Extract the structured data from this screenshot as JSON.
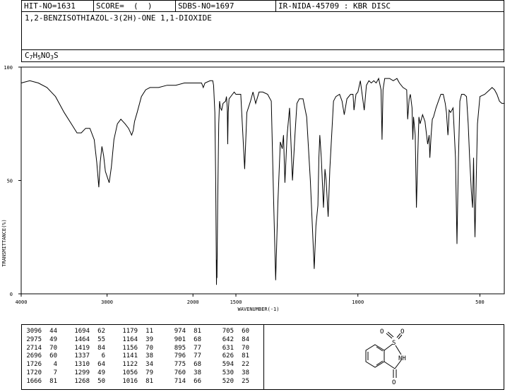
{
  "header": {
    "hit_no": "HIT-NO=1631",
    "score": "SCORE=  (  )",
    "sdbs_no": "SDBS-NO=1697",
    "source": "IR-NIDA-45709 : KBR DISC"
  },
  "compound": {
    "name": "1,2-BENZISOTHIAZOL-3(2H)-ONE 1,1-DIOXIDE",
    "formula_parts": [
      {
        "text": "C",
        "sub": false
      },
      {
        "text": "7",
        "sub": true
      },
      {
        "text": "H",
        "sub": false
      },
      {
        "text": "5",
        "sub": true
      },
      {
        "text": "NO",
        "sub": false
      },
      {
        "text": "3",
        "sub": true
      },
      {
        "text": "S",
        "sub": false
      }
    ]
  },
  "chart_data": {
    "type": "line",
    "title": "",
    "xlabel": "WAVENUMBER(-1)",
    "ylabel": "TRANSMITTANCE(%)",
    "xlim": [
      4000,
      400
    ],
    "ylim": [
      0,
      100
    ],
    "x_ticks": [
      4000,
      3000,
      2000,
      1500,
      1000,
      500
    ],
    "y_ticks": [
      0,
      50,
      100
    ],
    "grid": false,
    "series": [
      {
        "points": [
          [
            4000,
            93
          ],
          [
            3900,
            94
          ],
          [
            3800,
            93
          ],
          [
            3700,
            91
          ],
          [
            3600,
            87
          ],
          [
            3500,
            80
          ],
          [
            3400,
            74
          ],
          [
            3350,
            71
          ],
          [
            3300,
            71
          ],
          [
            3250,
            73
          ],
          [
            3200,
            73
          ],
          [
            3150,
            68
          ],
          [
            3120,
            58
          ],
          [
            3096,
            47
          ],
          [
            3080,
            58
          ],
          [
            3060,
            65
          ],
          [
            3040,
            61
          ],
          [
            3020,
            54
          ],
          [
            2975,
            49
          ],
          [
            2950,
            56
          ],
          [
            2920,
            68
          ],
          [
            2880,
            75
          ],
          [
            2840,
            77
          ],
          [
            2790,
            75
          ],
          [
            2750,
            73
          ],
          [
            2714,
            70
          ],
          [
            2696,
            72
          ],
          [
            2680,
            76
          ],
          [
            2650,
            80
          ],
          [
            2600,
            87
          ],
          [
            2550,
            90
          ],
          [
            2500,
            91
          ],
          [
            2400,
            91
          ],
          [
            2300,
            92
          ],
          [
            2200,
            92
          ],
          [
            2100,
            93
          ],
          [
            2000,
            93
          ],
          [
            1950,
            93
          ],
          [
            1900,
            93
          ],
          [
            1880,
            91
          ],
          [
            1860,
            93
          ],
          [
            1800,
            94
          ],
          [
            1770,
            94
          ],
          [
            1760,
            92
          ],
          [
            1745,
            80
          ],
          [
            1735,
            50
          ],
          [
            1726,
            4
          ],
          [
            1722,
            15
          ],
          [
            1720,
            7
          ],
          [
            1712,
            40
          ],
          [
            1700,
            75
          ],
          [
            1690,
            85
          ],
          [
            1680,
            82
          ],
          [
            1666,
            81
          ],
          [
            1650,
            84
          ],
          [
            1620,
            85
          ],
          [
            1610,
            87
          ],
          [
            1600,
            82
          ],
          [
            1595,
            66
          ],
          [
            1590,
            80
          ],
          [
            1580,
            86
          ],
          [
            1540,
            88
          ],
          [
            1520,
            89
          ],
          [
            1500,
            88
          ],
          [
            1480,
            88
          ],
          [
            1464,
            55
          ],
          [
            1455,
            80
          ],
          [
            1440,
            85
          ],
          [
            1430,
            89
          ],
          [
            1419,
            84
          ],
          [
            1405,
            89
          ],
          [
            1390,
            89
          ],
          [
            1370,
            88
          ],
          [
            1355,
            85
          ],
          [
            1345,
            40
          ],
          [
            1337,
            6
          ],
          [
            1328,
            40
          ],
          [
            1318,
            67
          ],
          [
            1310,
            64
          ],
          [
            1305,
            70
          ],
          [
            1299,
            49
          ],
          [
            1290,
            70
          ],
          [
            1280,
            82
          ],
          [
            1268,
            50
          ],
          [
            1258,
            70
          ],
          [
            1250,
            84
          ],
          [
            1240,
            86
          ],
          [
            1225,
            86
          ],
          [
            1210,
            78
          ],
          [
            1195,
            50
          ],
          [
            1179,
            11
          ],
          [
            1172,
            30
          ],
          [
            1164,
            39
          ],
          [
            1160,
            60
          ],
          [
            1156,
            70
          ],
          [
            1150,
            60
          ],
          [
            1141,
            38
          ],
          [
            1135,
            55
          ],
          [
            1130,
            50
          ],
          [
            1122,
            34
          ],
          [
            1115,
            55
          ],
          [
            1100,
            85
          ],
          [
            1090,
            87
          ],
          [
            1075,
            88
          ],
          [
            1065,
            85
          ],
          [
            1056,
            79
          ],
          [
            1045,
            86
          ],
          [
            1030,
            88
          ],
          [
            1020,
            88
          ],
          [
            1016,
            81
          ],
          [
            1008,
            88
          ],
          [
            1000,
            89
          ],
          [
            990,
            94
          ],
          [
            985,
            90
          ],
          [
            974,
            81
          ],
          [
            965,
            92
          ],
          [
            955,
            94
          ],
          [
            945,
            93
          ],
          [
            935,
            94
          ],
          [
            925,
            93
          ],
          [
            915,
            95
          ],
          [
            905,
            90
          ],
          [
            901,
            68
          ],
          [
            897,
            90
          ],
          [
            890,
            95
          ],
          [
            870,
            95
          ],
          [
            855,
            94
          ],
          [
            840,
            95
          ],
          [
            830,
            93
          ],
          [
            815,
            91
          ],
          [
            800,
            90
          ],
          [
            796,
            77
          ],
          [
            790,
            86
          ],
          [
            785,
            88
          ],
          [
            778,
            82
          ],
          [
            775,
            68
          ],
          [
            772,
            78
          ],
          [
            765,
            70
          ],
          [
            760,
            38
          ],
          [
            755,
            60
          ],
          [
            750,
            78
          ],
          [
            745,
            75
          ],
          [
            735,
            79
          ],
          [
            725,
            76
          ],
          [
            714,
            66
          ],
          [
            708,
            70
          ],
          [
            705,
            60
          ],
          [
            700,
            70
          ],
          [
            695,
            77
          ],
          [
            690,
            78
          ],
          [
            680,
            82
          ],
          [
            670,
            85
          ],
          [
            660,
            88
          ],
          [
            650,
            88
          ],
          [
            642,
            84
          ],
          [
            637,
            80
          ],
          [
            631,
            70
          ],
          [
            628,
            75
          ],
          [
            626,
            81
          ],
          [
            620,
            80
          ],
          [
            610,
            82
          ],
          [
            600,
            60
          ],
          [
            594,
            22
          ],
          [
            588,
            60
          ],
          [
            582,
            85
          ],
          [
            575,
            88
          ],
          [
            565,
            88
          ],
          [
            555,
            87
          ],
          [
            548,
            75
          ],
          [
            542,
            60
          ],
          [
            535,
            45
          ],
          [
            530,
            38
          ],
          [
            526,
            60
          ],
          [
            523,
            40
          ],
          [
            520,
            25
          ],
          [
            516,
            45
          ],
          [
            510,
            75
          ],
          [
            500,
            87
          ],
          [
            480,
            88
          ],
          [
            460,
            90
          ],
          [
            450,
            91
          ],
          [
            440,
            90
          ],
          [
            430,
            88
          ],
          [
            420,
            85
          ],
          [
            410,
            84
          ],
          [
            400,
            84
          ]
        ]
      }
    ]
  },
  "peak_table": {
    "columns": [
      [
        [
          "3096",
          "44"
        ],
        [
          "2975",
          "49"
        ],
        [
          "2714",
          "70"
        ],
        [
          "2696",
          "60"
        ],
        [
          "1726",
          "4"
        ],
        [
          "1720",
          "7"
        ],
        [
          "1666",
          "81"
        ]
      ],
      [
        [
          "1694",
          "62"
        ],
        [
          "1464",
          "55"
        ],
        [
          "1419",
          "84"
        ],
        [
          "1337",
          "6"
        ],
        [
          "1310",
          "64"
        ],
        [
          "1299",
          "49"
        ],
        [
          "1268",
          "50"
        ]
      ],
      [
        [
          "1179",
          "11"
        ],
        [
          "1164",
          "39"
        ],
        [
          "1156",
          "70"
        ],
        [
          "1141",
          "38"
        ],
        [
          "1122",
          "34"
        ],
        [
          "1056",
          "79"
        ],
        [
          "1016",
          "81"
        ]
      ],
      [
        [
          "974",
          "81"
        ],
        [
          "901",
          "68"
        ],
        [
          "895",
          "77"
        ],
        [
          "796",
          "77"
        ],
        [
          "775",
          "68"
        ],
        [
          "760",
          "38"
        ],
        [
          "714",
          "66"
        ]
      ],
      [
        [
          "705",
          "60"
        ],
        [
          "642",
          "84"
        ],
        [
          "631",
          "70"
        ],
        [
          "626",
          "81"
        ],
        [
          "594",
          "22"
        ],
        [
          "530",
          "38"
        ],
        [
          "520",
          "25"
        ]
      ]
    ]
  },
  "structure": {
    "atom_s": "S",
    "atom_o1": "O",
    "atom_o2": "O",
    "atom_nh": "NH",
    "atom_o3": "O"
  }
}
